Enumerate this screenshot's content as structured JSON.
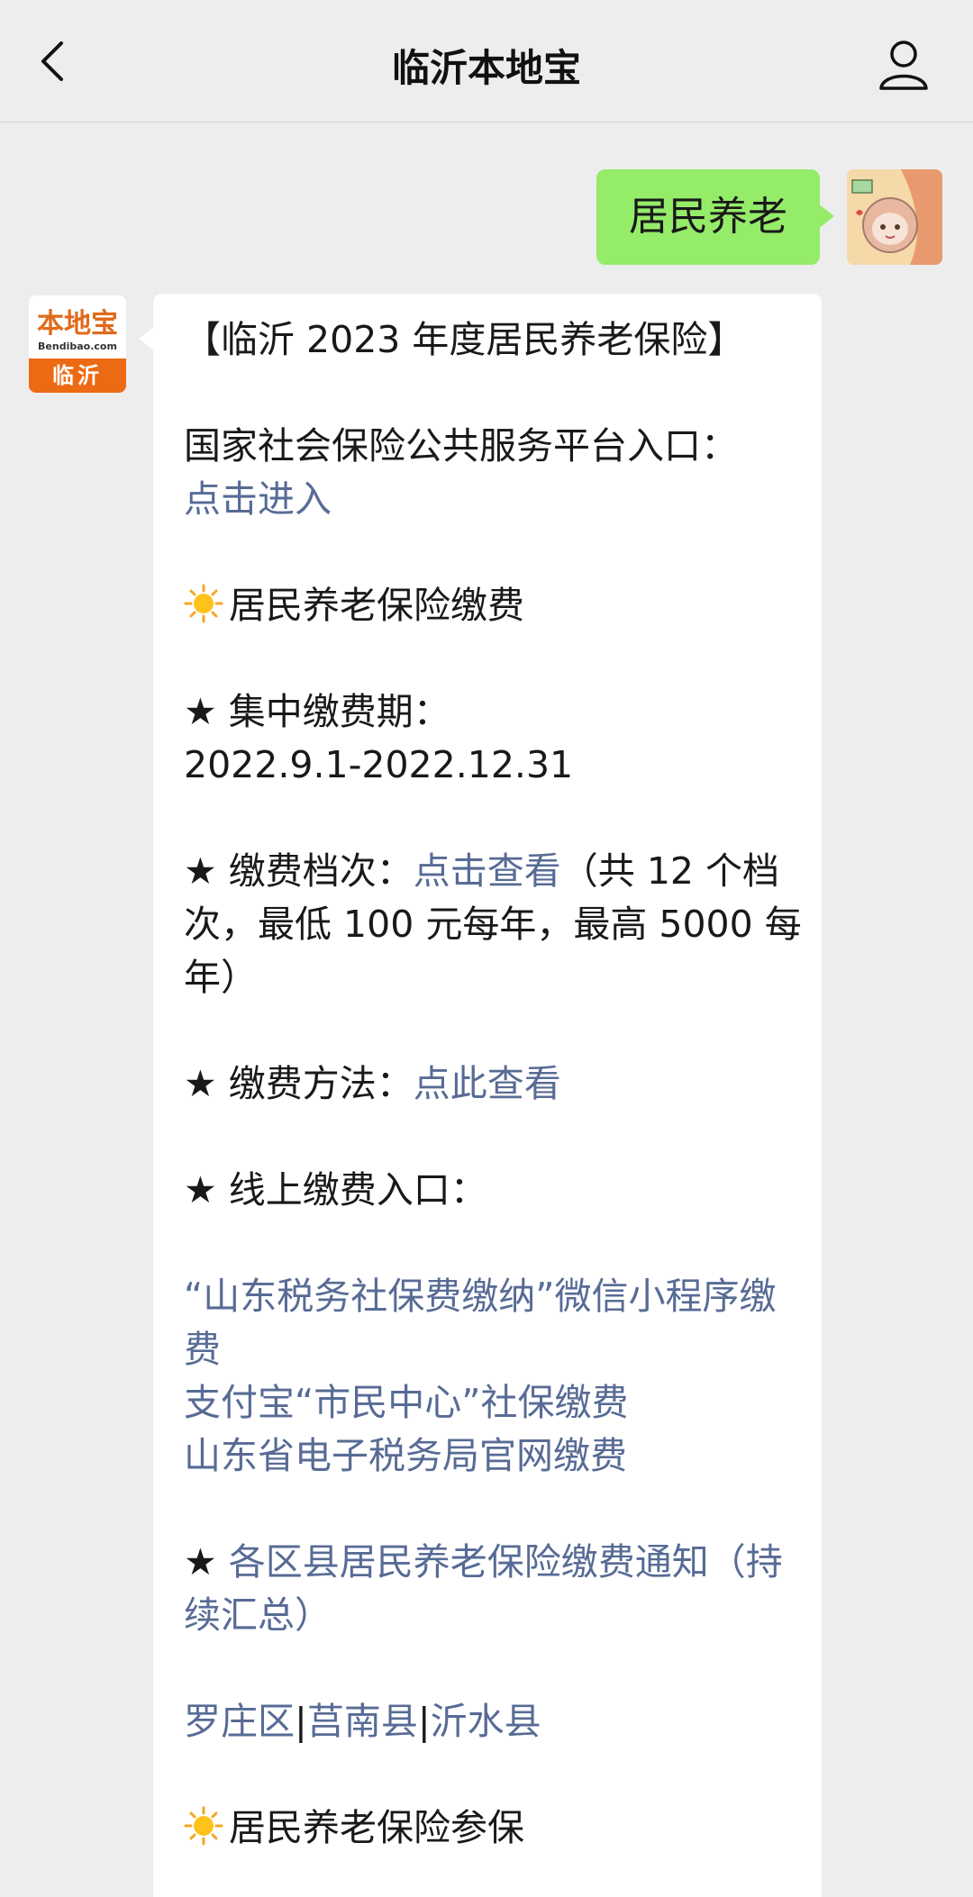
{
  "header": {
    "title": "临沂本地宝",
    "back_icon": "chevron-left-icon",
    "profile_icon": "person-icon"
  },
  "user_message": {
    "text": "居民养老"
  },
  "bot_avatar": {
    "logo_text": "本地宝",
    "logo_url": "Bendibao.com",
    "city": "临沂"
  },
  "bot_message": {
    "title": "【临沂 2023 年度居民养老保险】",
    "platform_label": "国家社会保险公共服务平台入口：",
    "platform_link": "点击进入",
    "payment_heading": "居民养老保险缴费",
    "period_label": "★ 集中缴费期：",
    "period_value": "2022.9.1-2022.12.31",
    "levels_label": "★ 缴费档次：",
    "levels_link": "点击查看",
    "levels_note": "（共 12 个档次，最低 100 元每年，最高 5000 每年）",
    "method_label": "★ 缴费方法：",
    "method_link": "点此查看",
    "online_label": "★ 线上缴费入口：",
    "online_links": [
      "“山东税务社保费缴纳”微信小程序缴费",
      "支付宝“市民中心”社保缴费",
      "山东省电子税务局官网缴费"
    ],
    "notice_star": "★ ",
    "notice_link": "各区县居民养老保险缴费通知（持续汇总）",
    "districts": [
      "罗庄区",
      "莒南县",
      "沂水县"
    ],
    "separator": "|",
    "enroll_heading": "居民养老保险参保"
  },
  "colors": {
    "background": "#ededed",
    "user_bubble": "#95ec69",
    "bot_bubble": "#ffffff",
    "link": "#576b95",
    "brand_orange": "#ec6a14"
  }
}
